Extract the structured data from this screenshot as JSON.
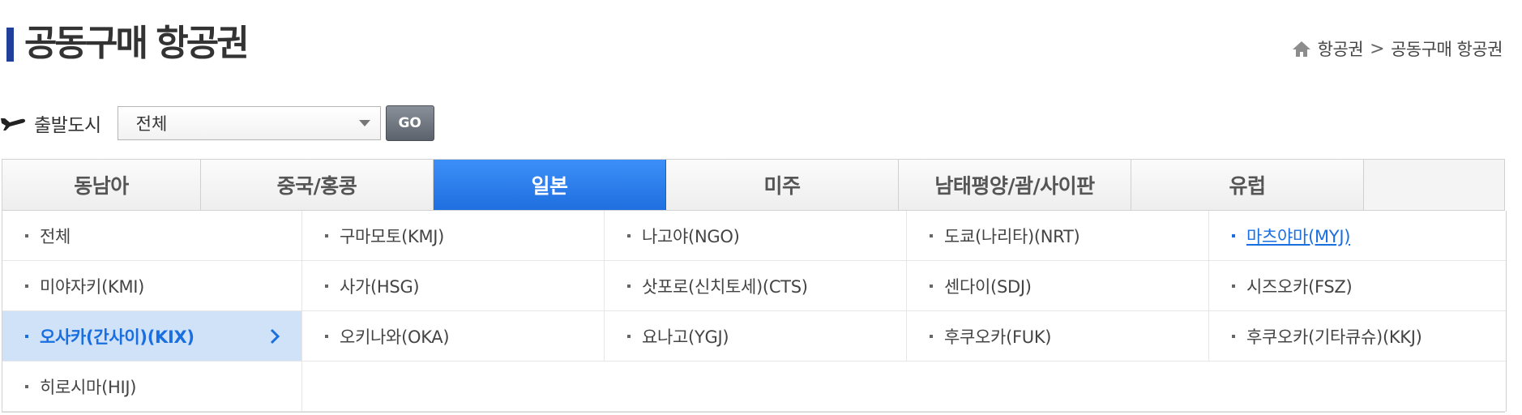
{
  "header": {
    "title": "공동구매 항공권",
    "breadcrumb": {
      "home_icon": "home-icon",
      "items": [
        "항공권",
        "공동구매 항공권"
      ],
      "separator": ">"
    }
  },
  "filter": {
    "icon": "plane-icon",
    "label": "출발도시",
    "select_value": "전체",
    "go_label": "GO"
  },
  "tabs": [
    {
      "label": "동남아",
      "active": false
    },
    {
      "label": "중국/홍콩",
      "active": false
    },
    {
      "label": "일본",
      "active": true
    },
    {
      "label": "미주",
      "active": false
    },
    {
      "label": "남태평양/괌/사이판",
      "active": false
    },
    {
      "label": "유럽",
      "active": false
    }
  ],
  "cities": [
    {
      "label": "전체",
      "state": "normal"
    },
    {
      "label": "구마모토(KMJ)",
      "state": "normal"
    },
    {
      "label": "나고야(NGO)",
      "state": "normal"
    },
    {
      "label": "도쿄(나리타)(NRT)",
      "state": "normal"
    },
    {
      "label": "마츠야마(MYJ)",
      "state": "link"
    },
    {
      "label": "미야자키(KMI)",
      "state": "normal"
    },
    {
      "label": "사가(HSG)",
      "state": "normal"
    },
    {
      "label": "삿포로(신치토세)(CTS)",
      "state": "normal"
    },
    {
      "label": "센다이(SDJ)",
      "state": "normal"
    },
    {
      "label": "시즈오카(FSZ)",
      "state": "normal"
    },
    {
      "label": "오사카(간사이)(KIX)",
      "state": "selected"
    },
    {
      "label": "오키나와(OKA)",
      "state": "normal"
    },
    {
      "label": "요나고(YGJ)",
      "state": "normal"
    },
    {
      "label": "후쿠오카(FUK)",
      "state": "normal"
    },
    {
      "label": "후쿠오카(기타큐슈)(KKJ)",
      "state": "normal"
    },
    {
      "label": "히로시마(HIJ)",
      "state": "normal"
    }
  ],
  "colors": {
    "accent": "#1f6fe0",
    "title_bar": "#1f3f9a",
    "selected_bg": "#cfe2f8"
  }
}
